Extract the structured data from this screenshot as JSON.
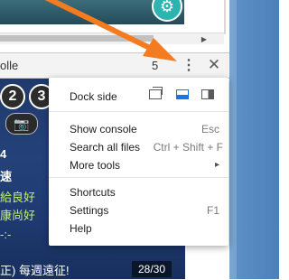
{
  "devtools": {
    "tab_label": "olle",
    "error_count": "5",
    "more_icon": "kebab-vertical-icon",
    "close_icon": "close-icon"
  },
  "game": {
    "bubbles": [
      "2",
      "3"
    ],
    "lines": [
      "4",
      "速",
      "給良好",
      "康尚好",
      "-:-",
      "正) 每週遠征!"
    ],
    "page_counter": "28/30"
  },
  "menu": {
    "dock_side_label": "Dock side",
    "dock_options": [
      "undock-icon",
      "dock-bottom-icon",
      "dock-right-icon"
    ],
    "items": [
      {
        "label": "Show console",
        "shortcut": "Esc"
      },
      {
        "label": "Search all files",
        "shortcut": "Ctrl + Shift + F"
      },
      {
        "label": "More tools",
        "shortcut": "▸"
      },
      {
        "label": "Shortcuts",
        "shortcut": ""
      },
      {
        "label": "Settings",
        "shortcut": "F1"
      },
      {
        "label": "Help",
        "shortcut": ""
      }
    ]
  },
  "colors": {
    "arrow": "#f47b20",
    "accent": "#1a73e8"
  }
}
